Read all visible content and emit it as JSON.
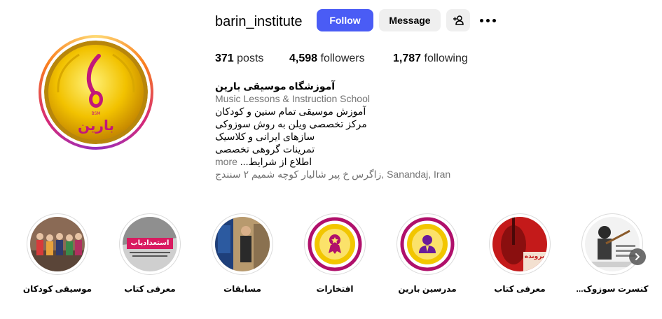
{
  "profile": {
    "username": "barin_institute",
    "follow_label": "Follow",
    "message_label": "Message",
    "avatar_logo_text": "بارین",
    "avatar_logo_abbr": "BSM"
  },
  "stats": {
    "posts_count": "371",
    "posts_label": "posts",
    "followers_count": "4,598",
    "followers_label": "followers",
    "following_count": "1,787",
    "following_label": "following"
  },
  "bio": {
    "name": "آموزشگاه موسیقی بارین",
    "category": "Music Lessons & Instruction School",
    "lines": [
      "آموزش موسیقی تمام سنین و کودکان",
      "مرکز تخصصی ویلن به روش سوزوکی",
      "سازهای ایرانی و کلاسیک",
      "تمرینات گروهی تخصصی",
      "اطلاع از شرایط..."
    ],
    "more_label": "more",
    "location": "زاگرس خ پیر شالیار کوچه شمیم ۲ سنندج, Sanandaj, Iran"
  },
  "highlights": [
    {
      "label": "موسیقی کودکان",
      "icon": "group-photo"
    },
    {
      "label": "معرفی کتاب",
      "icon": "book-cover",
      "overlay_text": "استعدادیاب"
    },
    {
      "label": "مسابقات",
      "icon": "competition-photo"
    },
    {
      "label": "افتخارات",
      "icon": "medal-icon"
    },
    {
      "label": "مدرسین بارین",
      "icon": "teacher-icon"
    },
    {
      "label": "معرفی کتاب",
      "icon": "violin-book-cover",
      "overlay_text": "پرونده"
    },
    {
      "label": "کنسرت سوزوک...",
      "icon": "concert-poster"
    }
  ],
  "colors": {
    "follow_button": "#4a5cf5",
    "secondary_button": "#efefef",
    "muted_text": "#737373",
    "avatar_gold": "#f5c400",
    "avatar_magenta": "#c2177a"
  }
}
